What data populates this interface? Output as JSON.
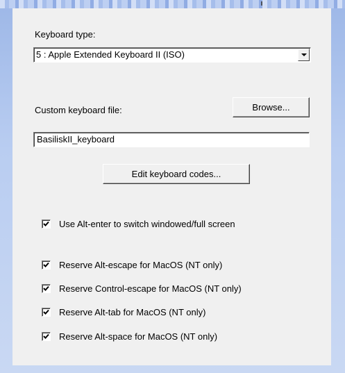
{
  "keyboard": {
    "type_label": "Keyboard type:",
    "type_value": "5 : Apple Extended Keyboard II (ISO)",
    "custom_file_label": "Custom keyboard file:",
    "browse_label": "Browse...",
    "custom_file_value": "BasiliskII_keyboard",
    "edit_codes_label": "Edit keyboard codes..."
  },
  "options": [
    {
      "label": "Use Alt-enter to switch windowed/full screen",
      "checked": true
    },
    {
      "label": "Reserve Alt-escape for MacOS (NT only)",
      "checked": true
    },
    {
      "label": "Reserve Control-escape for MacOS (NT only)",
      "checked": true
    },
    {
      "label": "Reserve Alt-tab for MacOS (NT only)",
      "checked": true
    },
    {
      "label": "Reserve Alt-space for MacOS (NT only)",
      "checked": true
    }
  ],
  "icons": {
    "dropdown": "chevron-down-icon",
    "checkmark": "checkmark-icon"
  }
}
